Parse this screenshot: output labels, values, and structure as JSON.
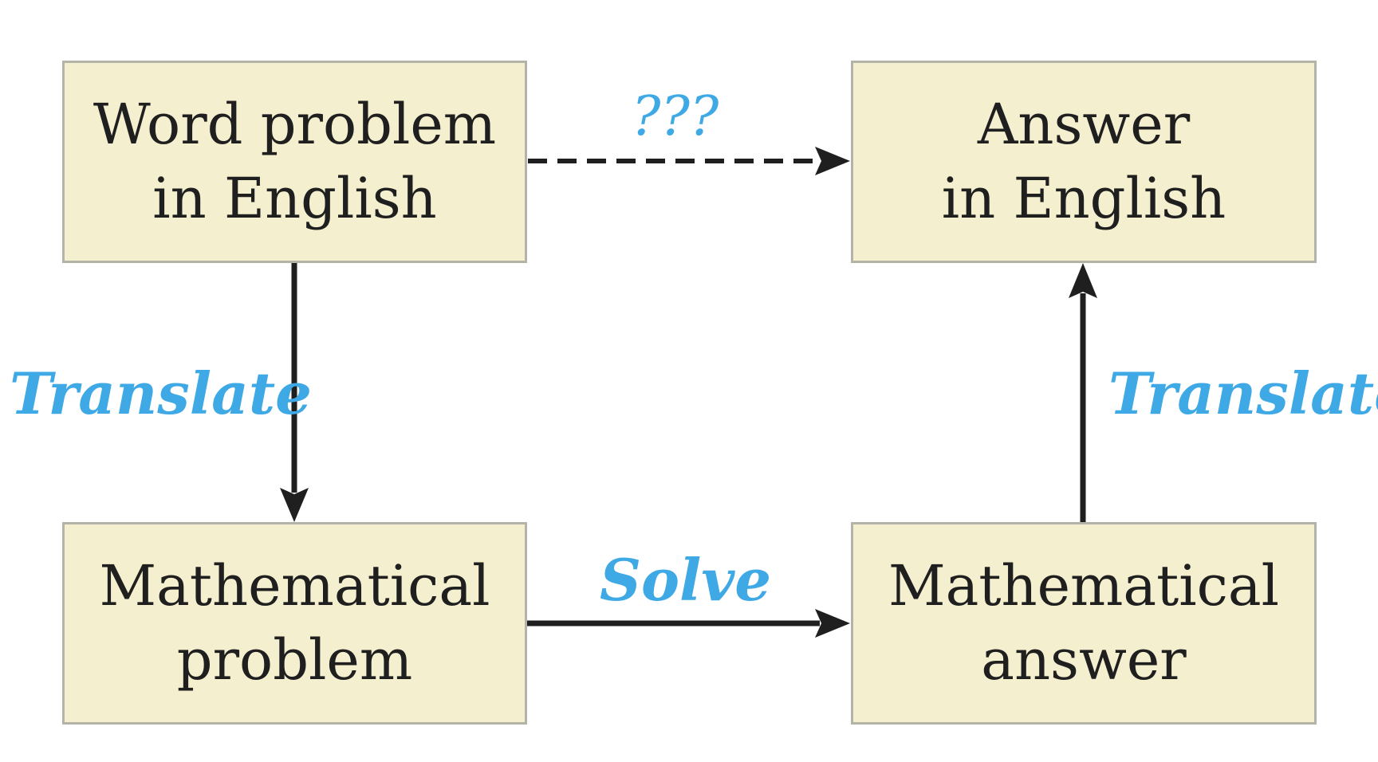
{
  "nodes": {
    "word_problem": {
      "line1": "Word problem",
      "line2": "in English"
    },
    "answer_english": {
      "line1": "Answer",
      "line2": "in English"
    },
    "math_problem": {
      "line1": "Mathematical",
      "line2": "problem"
    },
    "math_answer": {
      "line1": "Mathematical",
      "line2": "answer"
    }
  },
  "edges": {
    "unknown_path": {
      "label": "???",
      "style": "dashed"
    },
    "translate_down": {
      "label": "Translate"
    },
    "solve": {
      "label": "Solve"
    },
    "translate_up": {
      "label": "Translate"
    }
  },
  "colors": {
    "box_fill": "#f4efcf",
    "box_border": "#b3b3a8",
    "text": "#1f1f1f",
    "accent_label": "#3fa9e6",
    "arrow": "#1f1f1f"
  }
}
